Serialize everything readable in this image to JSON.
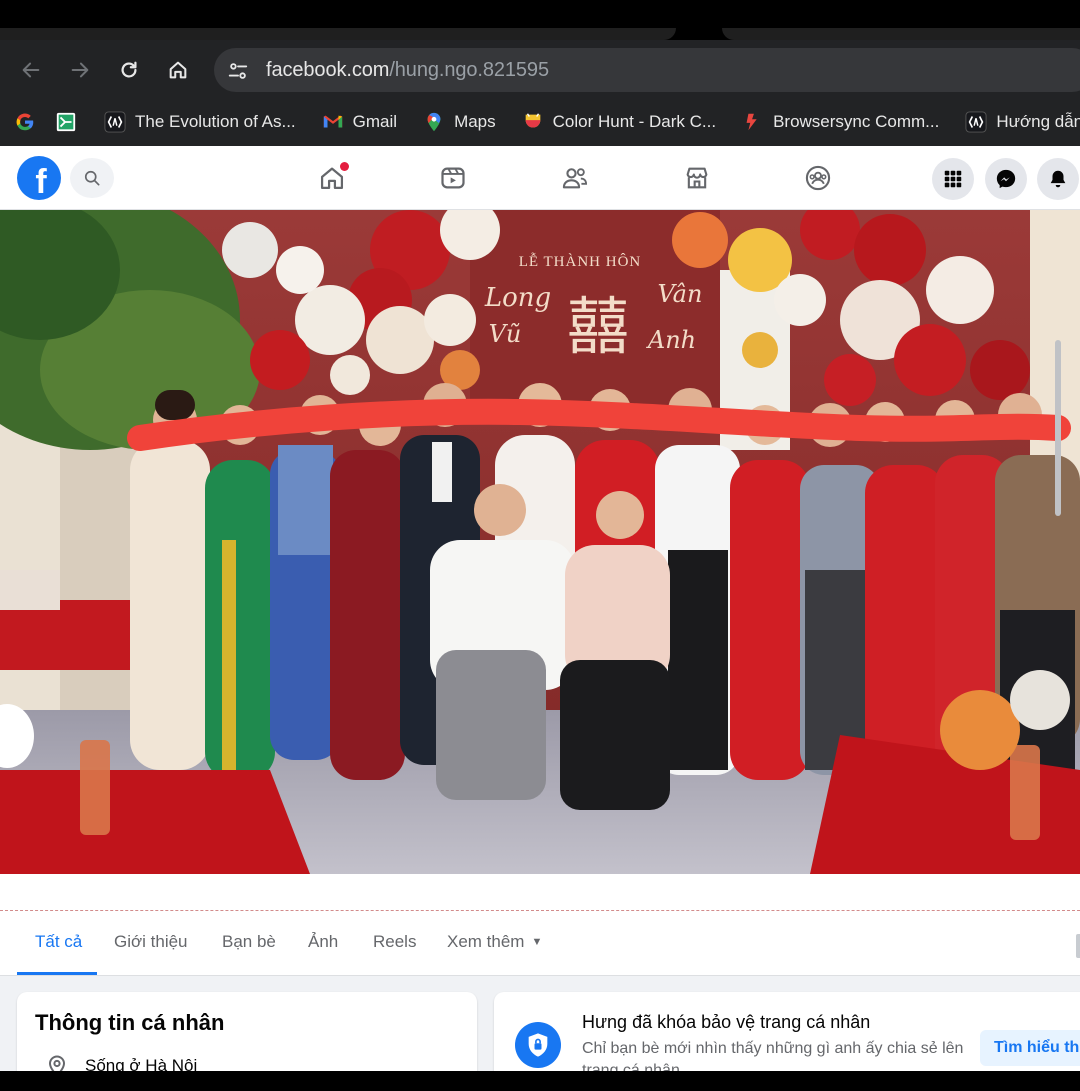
{
  "browser": {
    "url_domain": "facebook.com",
    "url_path": "/hung.ngo.821595",
    "bookmarks": [
      {
        "icon": "google-icon",
        "label": ""
      },
      {
        "icon": "sheets-icon",
        "label": ""
      },
      {
        "icon": "astro-icon",
        "label": "The Evolution of As..."
      },
      {
        "icon": "gmail-icon",
        "label": "Gmail"
      },
      {
        "icon": "maps-icon",
        "label": "Maps"
      },
      {
        "icon": "colorhunt-icon",
        "label": "Color Hunt - Dark C..."
      },
      {
        "icon": "browsersync-icon",
        "label": "Browsersync Comm..."
      },
      {
        "icon": "astro-icon",
        "label": "Hướng dẫn hoàn"
      }
    ]
  },
  "facebook": {
    "logo": "f",
    "nav_icons": [
      "home-icon",
      "video-icon",
      "friends-icon",
      "marketplace-icon",
      "groups-icon"
    ],
    "right_icons": [
      "menu-grid-icon",
      "messenger-icon",
      "bell-icon"
    ],
    "accent": "#1877f2"
  },
  "cover": {
    "sign_title": "LỄ THÀNH HÔN",
    "sign_name_left_top": "Long",
    "sign_name_left_bottom": "Vũ",
    "sign_name_right_top": "Vân",
    "sign_name_right_bottom": "Anh",
    "sign_symbol": "囍"
  },
  "tabs": [
    {
      "label": "Tất cả",
      "active": true
    },
    {
      "label": "Giới thiệu",
      "active": false
    },
    {
      "label": "Bạn bè",
      "active": false
    },
    {
      "label": "Ảnh",
      "active": false
    },
    {
      "label": "Reels",
      "active": false
    },
    {
      "label": "Xem thêm",
      "active": false
    }
  ],
  "intro": {
    "title": "Thông tin cá nhân",
    "lives_in": "Sống ở Hà Nội"
  },
  "locked": {
    "title": "Hưng đã khóa bảo vệ trang cá nhân",
    "description": "Chỉ bạn bè mới nhìn thấy những gì anh ấy chia sẻ lên trang cá nhân.",
    "button": "Tìm hiểu thêm"
  }
}
